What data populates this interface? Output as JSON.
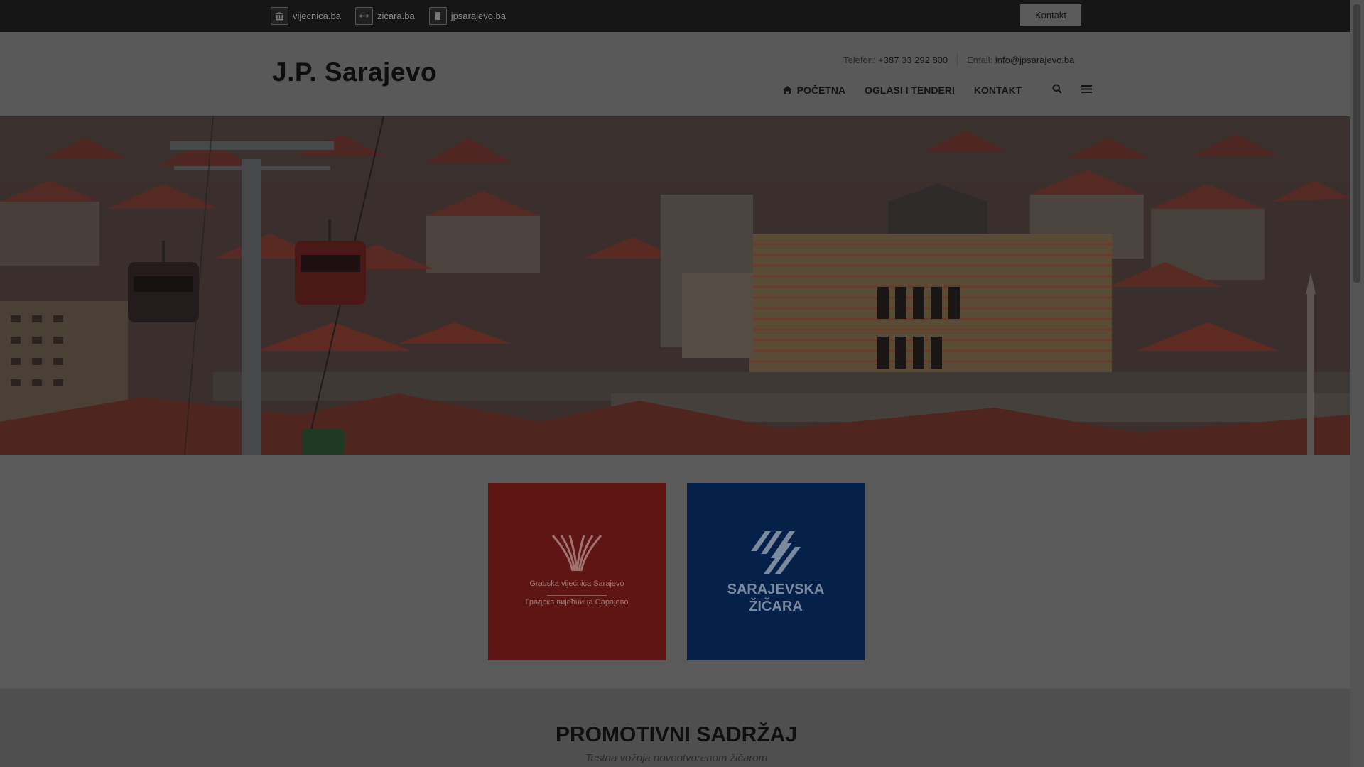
{
  "topbar": {
    "links": [
      {
        "label": "vijecnica.ba",
        "icon": "building-icon"
      },
      {
        "label": "zicara.ba",
        "icon": "cable-icon"
      },
      {
        "label": "jpsarajevo.ba",
        "icon": "document-icon"
      }
    ],
    "button_label": "Kontakt"
  },
  "header": {
    "logo": "J.P. Sarajevo",
    "phone_label": "Telefon:",
    "phone": "+387 33 292 800",
    "email_label": "Email:",
    "email": "info@jpsarajevo.ba"
  },
  "nav": {
    "items": [
      "POČETNA",
      "OGLASI I TENDERI",
      "KONTAKT"
    ],
    "home_icon": "home-icon",
    "search_icon": "search-icon",
    "menu_icon": "hamburger-menu-icon"
  },
  "tiles": {
    "vijecnica": {
      "line1": "Gradska vijećnica Sarajevo",
      "line2": "Градска вијећница Сарајево",
      "color": "#5e1513"
    },
    "zicara": {
      "line1": "SARAJEVSKA",
      "line2": "ŽIČARA",
      "color": "#052049"
    }
  },
  "promo": {
    "title": "PROMOTIVNI SADRŽAJ",
    "subtitle": "Testna vožnja novootvorenom žičarom"
  },
  "colors": {
    "topbar": "#161616",
    "header": "#595959",
    "overlay_dim": "#5a5a5a"
  }
}
